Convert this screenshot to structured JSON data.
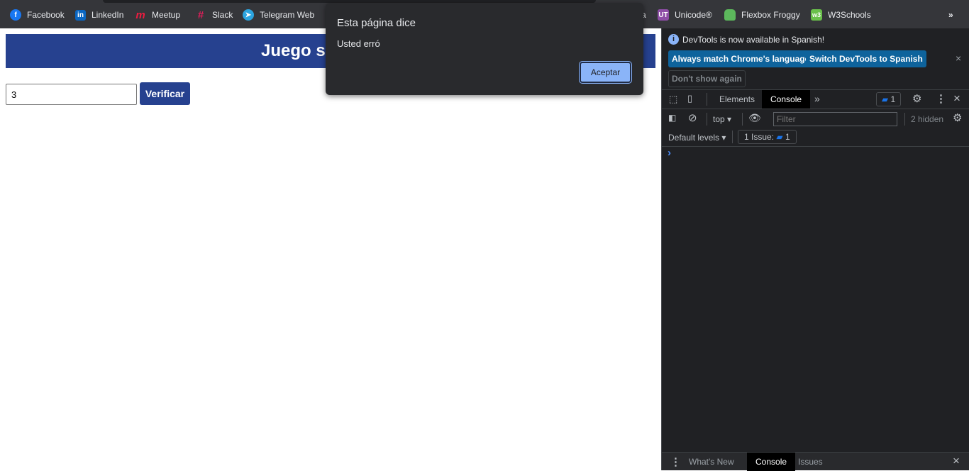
{
  "bookmarks": [
    {
      "label": "Facebook",
      "icon": "facebook-icon",
      "color": "#1877f2"
    },
    {
      "label": "LinkedIn",
      "icon": "linkedin-icon",
      "color": "#0a66c2"
    },
    {
      "label": "Meetup",
      "icon": "meetup-icon",
      "color": "#ed1c40"
    },
    {
      "label": "Slack",
      "icon": "slack-icon",
      "color": "#e01e5a"
    },
    {
      "label": "Telegram Web",
      "icon": "telegram-icon",
      "color": "#2ca5e0"
    },
    {
      "label": "a",
      "icon": "",
      "color": ""
    },
    {
      "label": "Unicode®",
      "icon": "unicode-icon",
      "color": "#8e4ea6"
    },
    {
      "label": "Flexbox Froggy",
      "icon": "frog-icon",
      "color": "#5cb85c"
    },
    {
      "label": "W3Schools",
      "icon": "w3schools-icon",
      "color": "#6ac04b"
    }
  ],
  "bookmarks_more": "»",
  "page": {
    "title": "Juego s",
    "input_value": "3",
    "verify_label": "Verificar",
    "brand_color": "#26418f"
  },
  "dialog": {
    "title": "Esta página dice",
    "message": "Usted erró",
    "ok_label": "Aceptar"
  },
  "devtools": {
    "notice": "DevTools is now available in Spanish!",
    "btn_match": "Always match Chrome's language",
    "btn_switch": "Switch DevTools to Spanish",
    "btn_dont": "Don't show again",
    "tabs": [
      "Elements",
      "Console"
    ],
    "active_tab": "Console",
    "issues_badge": "1",
    "context": "top",
    "filter_placeholder": "Filter",
    "hidden": "2 hidden",
    "levels": "Default levels",
    "issue_label": "1 Issue:",
    "issue_count": "1",
    "prompt": "›",
    "drawer_tabs": [
      "What's New",
      "Console",
      "Issues"
    ]
  }
}
